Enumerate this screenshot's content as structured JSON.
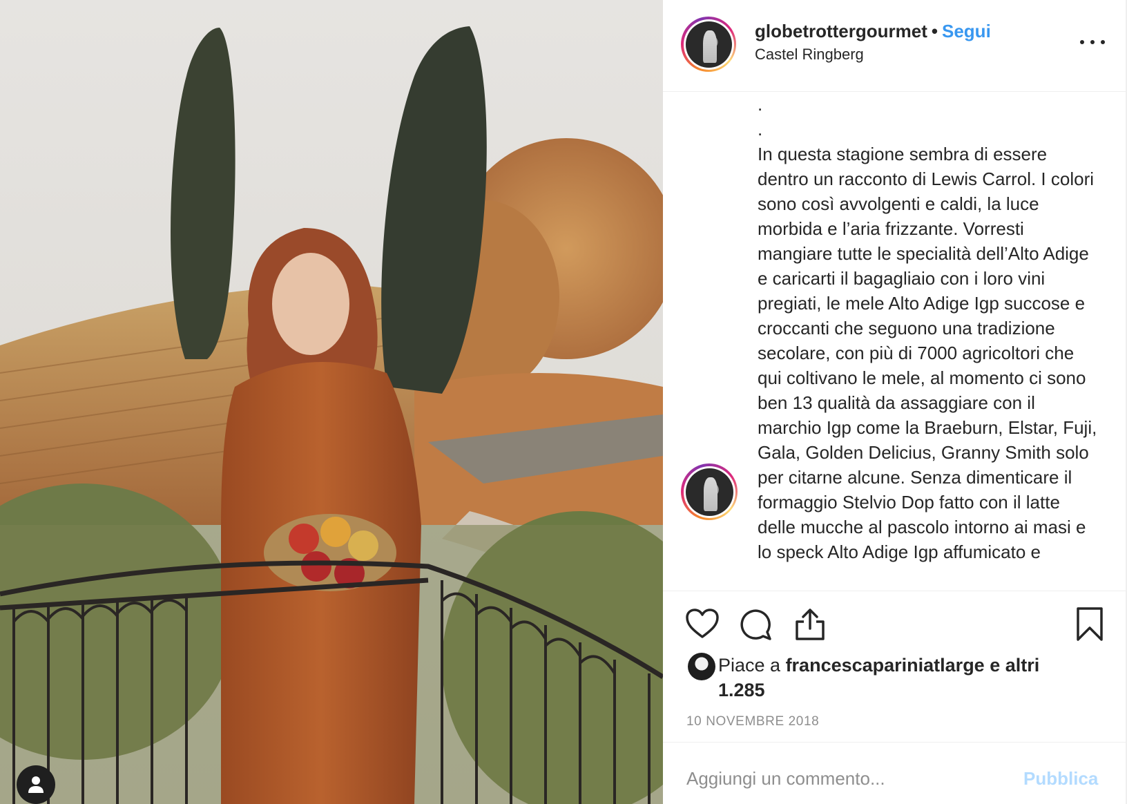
{
  "post": {
    "username": "globetrottergourmet",
    "separator": "•",
    "follow_label": "Segui",
    "location": "Castel Ringberg"
  },
  "caption": {
    "text": ".\n.\nIn questa stagione sembra di essere dentro un racconto di Lewis Carrol. I colori sono così avvolgenti e caldi, la luce morbida e l’aria frizzante. Vorresti mangiare tutte le specialità dell’Alto Adige e caricarti il bagagliaio con i loro vini pregiati, le mele Alto Adige Igp succose e croccanti che seguono una tradizione secolare, con più di 7000 agricoltori che qui coltivano le mele, al momento ci sono ben 13 qualità da assaggiare con il marchio Igp come la Braeburn, Elstar, Fuji, Gala, Golden Delicius, Granny Smith solo per citarne alcune. Senza dimenticare il formaggio Stelvio Dop fatto con il latte delle mucche al pascolo intorno ai masi e lo speck Alto Adige Igp affumicato e"
  },
  "likes": {
    "prefix": "Piace a ",
    "user": "francescapariniatlarge",
    "suffix": " e altri 1.285"
  },
  "date": "10 NOVEMBRE 2018",
  "comment": {
    "placeholder": "Aggiungi un commento...",
    "publish_label": "Pubblica"
  },
  "icons": {
    "like": "heart-icon",
    "comment": "comment-icon",
    "share": "share-icon",
    "save": "bookmark-icon",
    "more": "more-icon",
    "tags": "user-tag-icon"
  },
  "colors": {
    "follow": "#3897f0",
    "publish_disabled": "#b3dbff",
    "muted": "#8e8e8e",
    "text": "#262626"
  }
}
